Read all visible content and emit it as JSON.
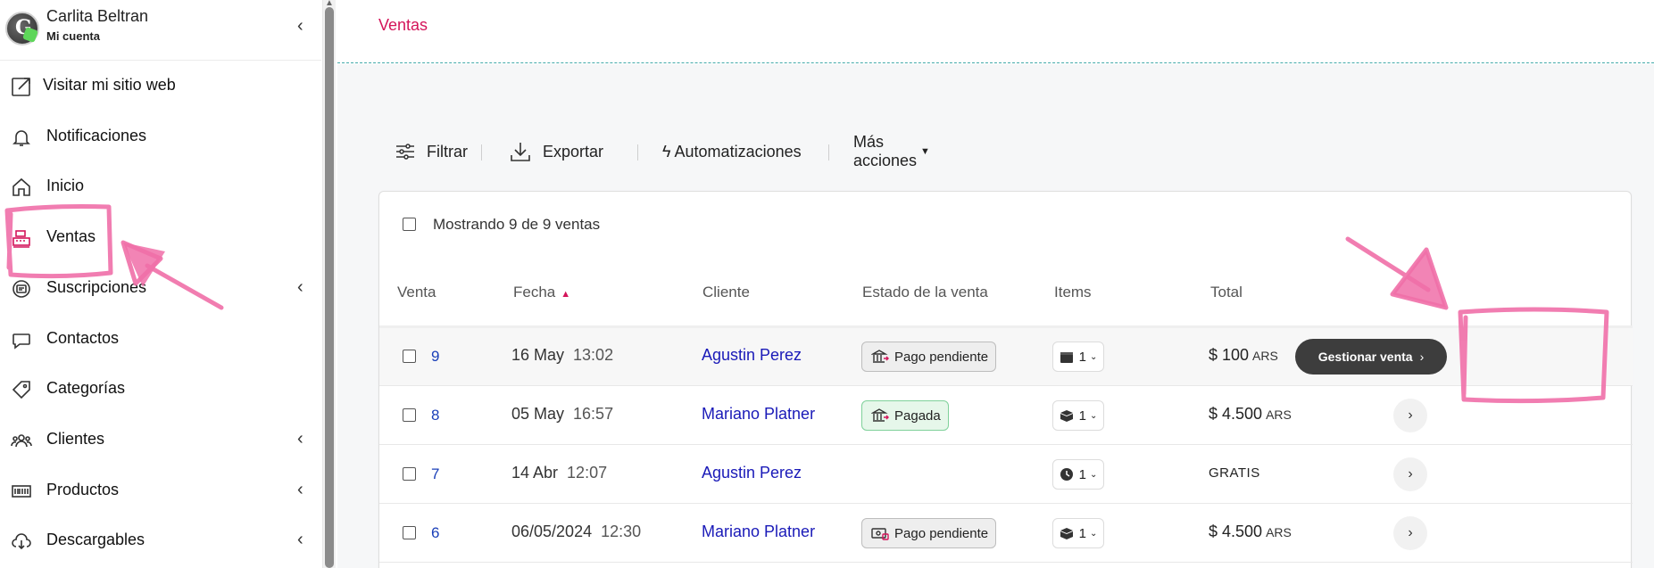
{
  "account": {
    "avatar_letter": "G",
    "name": "Carlita Beltran",
    "subtitle": "Mi cuenta",
    "chevron": "‹"
  },
  "sidebar": {
    "items": [
      {
        "label": "Visitar mi sitio web",
        "icon": "external-edit-icon",
        "chevron": ""
      },
      {
        "label": "Notificaciones",
        "icon": "bell-icon",
        "chevron": ""
      },
      {
        "label": "Inicio",
        "icon": "home-icon",
        "chevron": ""
      },
      {
        "label": "Ventas",
        "icon": "cash-register-icon",
        "chevron": ""
      },
      {
        "label": "Suscripciones",
        "icon": "subscription-icon",
        "chevron": "‹"
      },
      {
        "label": "Contactos",
        "icon": "chat-bubble-icon",
        "chevron": ""
      },
      {
        "label": "Categorías",
        "icon": "tag-icon",
        "chevron": ""
      },
      {
        "label": "Clientes",
        "icon": "users-icon",
        "chevron": "‹"
      },
      {
        "label": "Productos",
        "icon": "barcode-icon",
        "chevron": "‹"
      },
      {
        "label": "Descargables",
        "icon": "cloud-download-icon",
        "chevron": "‹"
      }
    ]
  },
  "main": {
    "title": "Ventas",
    "toolbar": {
      "filter": "Filtrar",
      "export": "Exportar",
      "automations": "Automatizaciones",
      "more": "Más acciones"
    },
    "showing": "Mostrando 9 de 9 ventas",
    "columns": {
      "venta": "Venta",
      "fecha": "Fecha",
      "cliente": "Cliente",
      "estado": "Estado de la venta",
      "items": "Items",
      "total": "Total"
    },
    "manage_label": "Gestionar venta",
    "rows": [
      {
        "id": "9",
        "date": "16 May",
        "time": "13:02",
        "client": "Agustin Perez",
        "status": "Pago pendiente",
        "status_kind": "pending",
        "items_icon": "calendar-icon",
        "items": "1",
        "total": "$ 100",
        "currency": "ARS"
      },
      {
        "id": "8",
        "date": "05 May",
        "time": "16:57",
        "client": "Mariano Platner",
        "status": "Pagada",
        "status_kind": "paid",
        "items_icon": "box-icon",
        "items": "1",
        "total": "$ 4.500",
        "currency": "ARS"
      },
      {
        "id": "7",
        "date": "14 Abr",
        "time": "12:07",
        "client": "Agustin Perez",
        "status": "",
        "status_kind": "none",
        "items_icon": "clock-icon",
        "items": "1",
        "total": "GRATIS",
        "currency": ""
      },
      {
        "id": "6",
        "date": "06/05/2024",
        "time": "12:30",
        "client": "Mariano Platner",
        "status": "Pago pendiente",
        "status_kind": "pending",
        "items_icon": "box-icon",
        "items": "1",
        "total": "$ 4.500",
        "currency": "ARS"
      }
    ]
  },
  "colors": {
    "accent": "#d4145a",
    "link": "#1a1ab8",
    "annotation": "#f06fa8",
    "paid_bg": "#e6f7ea",
    "manage_btn": "#3d3d3d"
  }
}
